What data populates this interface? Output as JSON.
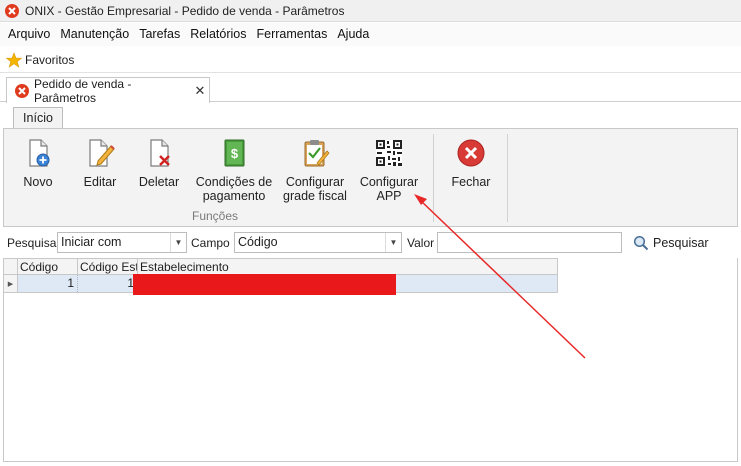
{
  "window": {
    "title": "ONIX - Gestão Empresarial - Pedido de venda - Parâmetros"
  },
  "menu": {
    "items": [
      "Arquivo",
      "Manutenção",
      "Tarefas",
      "Relatórios",
      "Ferramentas",
      "Ajuda"
    ]
  },
  "favorites": {
    "label": "Favoritos"
  },
  "doc_tab": {
    "label": "Pedido de venda - Parâmetros",
    "close": "✕"
  },
  "ribbon": {
    "tab": "Início",
    "group_label": "Funções",
    "buttons": {
      "novo": "Novo",
      "editar": "Editar",
      "deletar": "Deletar",
      "condicoes_l1": "Condições de",
      "condicoes_l2": "pagamento",
      "grade_l1": "Configurar",
      "grade_l2": "grade fiscal",
      "app_l1": "Configurar",
      "app_l2": "APP",
      "fechar": "Fechar"
    }
  },
  "search": {
    "pesquisa_label": "Pesquisa",
    "pesquisa_value": "Iniciar com",
    "campo_label": "Campo",
    "campo_value": "Código",
    "valor_label": "Valor",
    "valor_value": "",
    "button_label": "Pesquisar"
  },
  "grid": {
    "columns": [
      "Código",
      "Código Esta",
      "Estabelecimento"
    ],
    "rows": [
      {
        "codigo": "1",
        "codigo_estab": "1",
        "estabelecimento": ""
      }
    ]
  },
  "colors": {
    "accent": "#e8181b",
    "ribbon_bg": "#f3f3f3",
    "selected_row": "#dfe9f5"
  }
}
